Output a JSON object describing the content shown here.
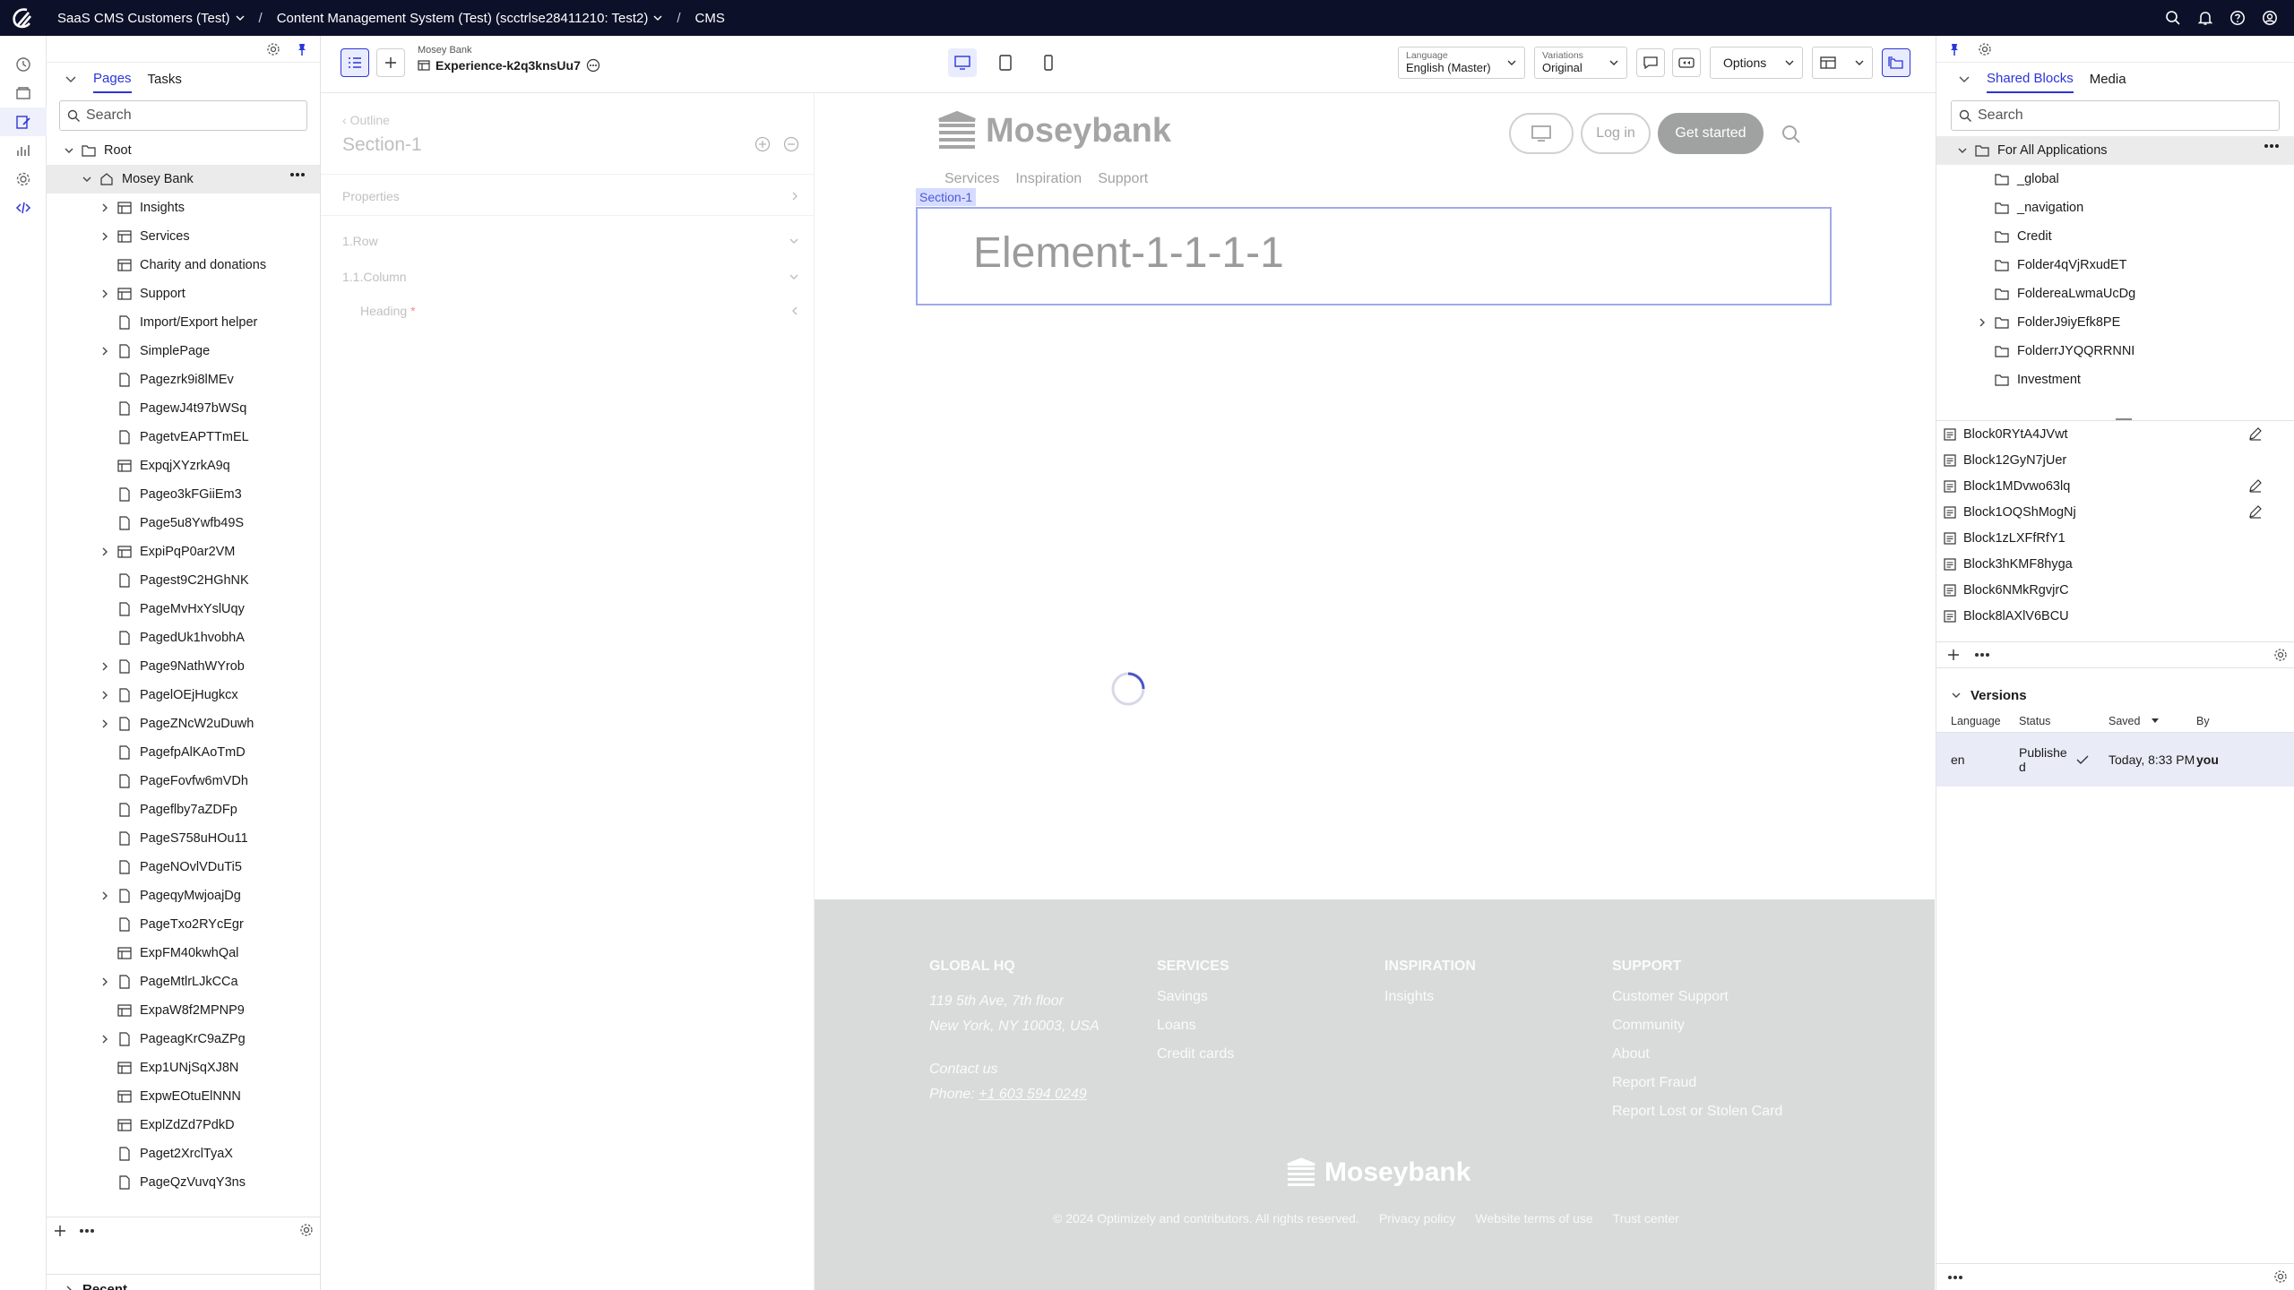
{
  "colors": {
    "topbar": "#0d1029",
    "accent": "#2b35d8",
    "selected_row": "#ebebeb",
    "version_row": "#e9ecf7"
  },
  "topbar": {
    "breadcrumbs": [
      "SaaS CMS Customers (Test)",
      "Content Management System (Test) (scctrlse28411210: Test2)",
      "CMS"
    ],
    "separator": "/",
    "icons": [
      "search-icon",
      "bell-icon",
      "help-icon",
      "user-icon"
    ]
  },
  "rail": {
    "icons": [
      "dashboard-icon",
      "content-icon",
      "edit-icon",
      "analytics-icon",
      "settings-icon",
      "code-icon"
    ]
  },
  "nav": {
    "tabs": [
      "Pages",
      "Tasks"
    ],
    "search_placeholder": "Search",
    "root": "Root",
    "site": "Mosey Bank",
    "items": [
      {
        "label": "Insights",
        "type": "block",
        "expand": true
      },
      {
        "label": "Services",
        "type": "block",
        "expand": true
      },
      {
        "label": "Charity and donations",
        "type": "block",
        "expand": false
      },
      {
        "label": "Support",
        "type": "block",
        "expand": true
      },
      {
        "label": "Import/Export helper",
        "type": "page",
        "expand": false
      },
      {
        "label": "SimplePage",
        "type": "page",
        "expand": true
      },
      {
        "label": "Pagezrk9i8lMEv",
        "type": "page",
        "expand": false
      },
      {
        "label": "PagewJ4t97bWSq",
        "type": "page",
        "expand": false
      },
      {
        "label": "PagetvEAPTTmEL",
        "type": "page",
        "expand": false
      },
      {
        "label": "ExpqjXYzrkA9q",
        "type": "block",
        "expand": false
      },
      {
        "label": "Pageo3kFGiiEm3",
        "type": "page",
        "expand": false
      },
      {
        "label": "Page5u8Ywfb49S",
        "type": "page",
        "expand": false
      },
      {
        "label": "ExpiPqP0ar2VM",
        "type": "block",
        "expand": true
      },
      {
        "label": "Pagest9C2HGhNK",
        "type": "page",
        "expand": false
      },
      {
        "label": "PageMvHxYslUqy",
        "type": "page",
        "expand": false
      },
      {
        "label": "PagedUk1hvobhA",
        "type": "page",
        "expand": false
      },
      {
        "label": "Page9NathWYrob",
        "type": "page",
        "expand": true
      },
      {
        "label": "PagelOEjHugkcx",
        "type": "page",
        "expand": true
      },
      {
        "label": "PageZNcW2uDuwh",
        "type": "page",
        "expand": true
      },
      {
        "label": "PagefpAlKAoTmD",
        "type": "page",
        "expand": false
      },
      {
        "label": "PageFovfw6mVDh",
        "type": "page",
        "expand": false
      },
      {
        "label": "Pageflby7aZDFp",
        "type": "page",
        "expand": false
      },
      {
        "label": "PageS758uHOu11",
        "type": "page",
        "expand": false
      },
      {
        "label": "PageNOvlVDuTi5",
        "type": "page",
        "expand": false
      },
      {
        "label": "PageqyMwjoajDg",
        "type": "page",
        "expand": true
      },
      {
        "label": "PageTxo2RYcEgr",
        "type": "page",
        "expand": false
      },
      {
        "label": "ExpFM40kwhQal",
        "type": "block",
        "expand": false
      },
      {
        "label": "PageMtlrLJkCCa",
        "type": "page",
        "expand": true
      },
      {
        "label": "ExpaW8f2MPNP9",
        "type": "block",
        "expand": false
      },
      {
        "label": "PageagKrC9aZPg",
        "type": "page",
        "expand": true
      },
      {
        "label": "Exp1UNjSqXJ8N",
        "type": "block",
        "expand": false
      },
      {
        "label": "ExpwEOtuElNNN",
        "type": "block",
        "expand": false
      },
      {
        "label": "ExplZdZd7PdkD",
        "type": "block",
        "expand": false
      },
      {
        "label": "Paget2XrclTyaX",
        "type": "page",
        "expand": false
      },
      {
        "label": "PageQzVuvqY3ns",
        "type": "page",
        "expand": false
      }
    ],
    "recent": "Recent"
  },
  "editor": {
    "site_name": "Mosey Bank",
    "experience_name": "Experience-k2q3knsUu7",
    "language": {
      "label": "Language",
      "value": "English (Master)"
    },
    "variations": {
      "label": "Variations",
      "value": "Original"
    },
    "options_label": "Options"
  },
  "outline": {
    "back_label": "Outline",
    "section_title": "Section-1",
    "properties_label": "Properties",
    "row_label": "1.Row",
    "column_label": "1.1.Column",
    "heading_label": "Heading",
    "required_mark": "*"
  },
  "canvas": {
    "brand": "Moseybank",
    "login_label": "Log in",
    "get_started_label": "Get started",
    "menu": [
      "Services",
      "Inspiration",
      "Support"
    ],
    "section_tag": "Section-1",
    "element_heading": "Element-1-1-1-1",
    "footer": {
      "hq_title": "GLOBAL HQ",
      "address_line1": "119 5th Ave, 7th floor",
      "address_line2": "New York, NY 10003, USA",
      "contact_title": "Contact us",
      "phone_prefix": "Phone:",
      "phone": "+1 603 594 0249",
      "services_title": "SERVICES",
      "services": [
        "Savings",
        "Loans",
        "Credit cards"
      ],
      "inspiration_title": "INSPIRATION",
      "inspiration": [
        "Insights"
      ],
      "support_title": "SUPPORT",
      "support": [
        "Customer Support",
        "Community",
        "About",
        "Report Fraud",
        "Report Lost or Stolen Card"
      ],
      "brand": "Moseybank",
      "copyright": "© 2024 Optimizely and contributors. All rights reserved.",
      "privacy": "Privacy policy",
      "terms": "Website terms of use",
      "trust": "Trust center"
    }
  },
  "right": {
    "tabs": [
      "Shared Blocks",
      "Media"
    ],
    "search_placeholder": "Search",
    "root_folder": "For All Applications",
    "folders": [
      {
        "label": "_global",
        "expand": false
      },
      {
        "label": "_navigation",
        "expand": false
      },
      {
        "label": "Credit",
        "expand": false
      },
      {
        "label": "Folder4qVjRxudET",
        "expand": false
      },
      {
        "label": "FoldereaLwmaUcDg",
        "expand": false
      },
      {
        "label": "FolderJ9iyEfk8PE",
        "expand": true
      },
      {
        "label": "FolderrJYQQRRNNI",
        "expand": false
      },
      {
        "label": "Investment",
        "expand": false
      }
    ],
    "blocks": [
      {
        "label": "Block0RYtA4JVwt",
        "edit": true
      },
      {
        "label": "Block12GyN7jUer",
        "edit": false
      },
      {
        "label": "Block1MDvwo63lq",
        "edit": true
      },
      {
        "label": "Block1OQShMogNj",
        "edit": true
      },
      {
        "label": "Block1zLXFfRfY1",
        "edit": false
      },
      {
        "label": "Block3hKMF8hyga",
        "edit": false
      },
      {
        "label": "Block6NMkRgvjrC",
        "edit": false
      },
      {
        "label": "Block8lAXlV6BCU",
        "edit": false
      }
    ],
    "versions": {
      "title": "Versions",
      "columns": [
        "Language",
        "Status",
        "Saved",
        "By"
      ],
      "row": {
        "language": "en",
        "status": "Published",
        "saved": "Today, 8:33 PM",
        "by": "you"
      }
    }
  }
}
